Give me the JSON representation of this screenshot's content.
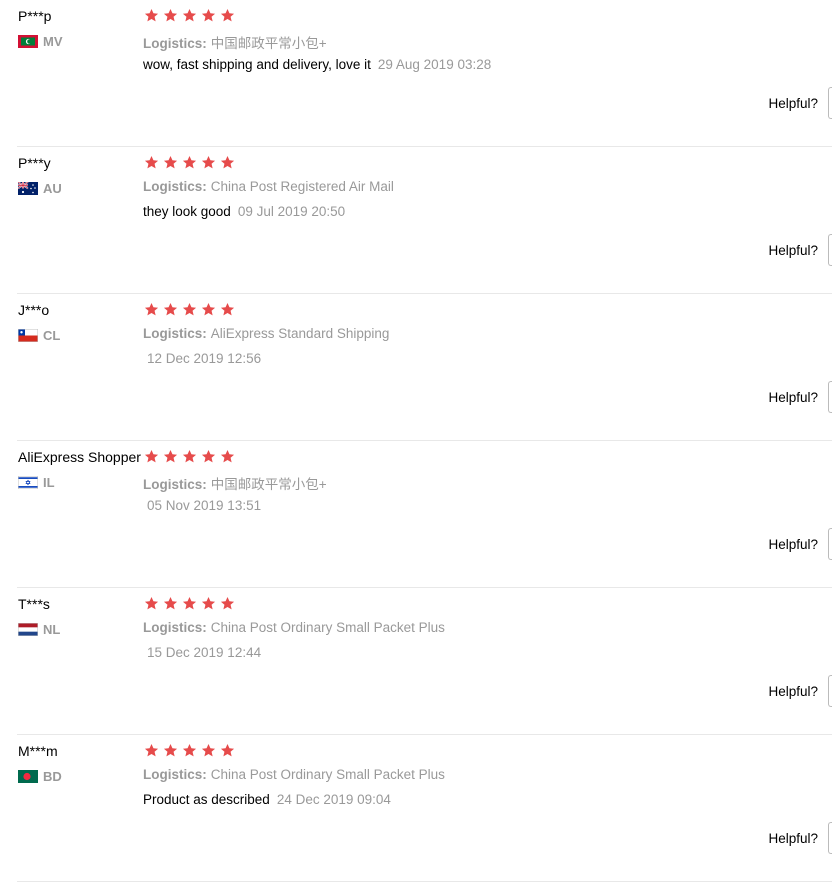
{
  "logistics_label": "Logistics:",
  "helpful_label": "Helpful?",
  "colors": {
    "star": "#e64b4b",
    "meta_text": "#999999",
    "divider": "#e8e8e8"
  },
  "reviews": [
    {
      "user": "P***p",
      "country_code": "MV",
      "flag_icon": "flag-mv-icon",
      "rating": 5,
      "logistics": "中国邮政平常小包+",
      "text": "wow, fast shipping and delivery, love it",
      "date": "29 Aug 2019 03:28"
    },
    {
      "user": "P***y",
      "country_code": "AU",
      "flag_icon": "flag-au-icon",
      "rating": 5,
      "logistics": "China Post Registered Air Mail",
      "text": "they look good",
      "date": "09 Jul 2019 20:50"
    },
    {
      "user": "J***o",
      "country_code": "CL",
      "flag_icon": "flag-cl-icon",
      "rating": 5,
      "logistics": "AliExpress Standard Shipping",
      "text": "",
      "date": "12 Dec 2019 12:56"
    },
    {
      "user": "AliExpress Shopper",
      "country_code": "IL",
      "flag_icon": "flag-il-icon",
      "rating": 5,
      "logistics": "中国邮政平常小包+",
      "text": "",
      "date": "05 Nov 2019 13:51"
    },
    {
      "user": "T***s",
      "country_code": "NL",
      "flag_icon": "flag-nl-icon",
      "rating": 5,
      "logistics": "China Post Ordinary Small Packet Plus",
      "text": "",
      "date": "15 Dec 2019 12:44"
    },
    {
      "user": "M***m",
      "country_code": "BD",
      "flag_icon": "flag-bd-icon",
      "rating": 5,
      "logistics": "China Post Ordinary Small Packet Plus",
      "text": "Product as described",
      "date": "24 Dec 2019 09:04"
    }
  ]
}
